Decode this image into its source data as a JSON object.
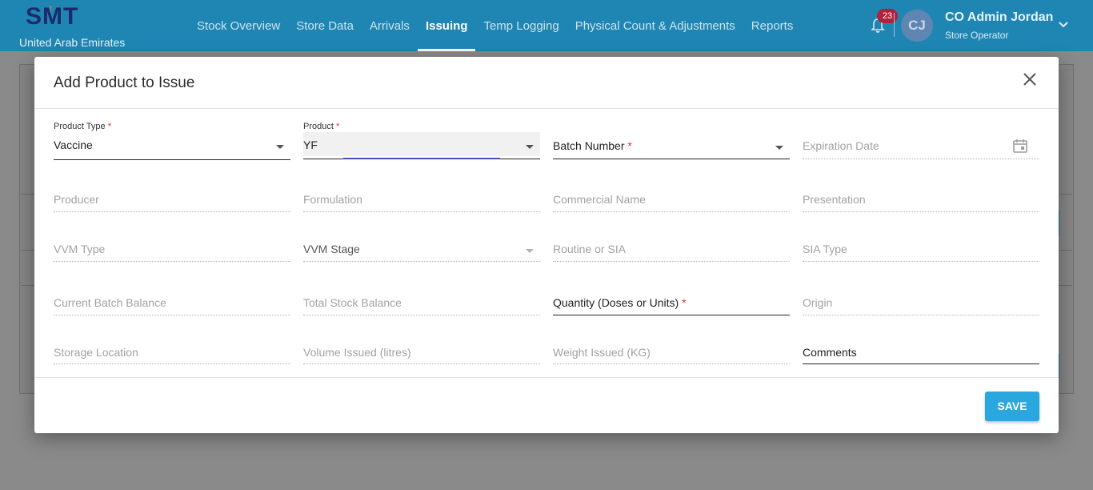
{
  "app": {
    "logo_text": "SMT",
    "country": "United Arab Emirates",
    "nav": [
      "Stock Overview",
      "Store Data",
      "Arrivals",
      "Issuing",
      "Temp Logging",
      "Physical Count & Adjustments",
      "Reports"
    ],
    "active_nav": "Issuing",
    "notifications_count": "23",
    "user": {
      "initials": "CJ",
      "name": "CO Admin Jordan",
      "role": "Store Operator"
    }
  },
  "modal": {
    "title": "Add Product to Issue",
    "save_label": "SAVE",
    "required_mark": "*",
    "fields": {
      "product_type": {
        "label": "Product Type",
        "value": "Vaccine"
      },
      "product": {
        "label": "Product",
        "value": "YF"
      },
      "batch_number": {
        "label": "Batch Number"
      },
      "expiration_date": {
        "label": "Expiration Date"
      },
      "producer": {
        "label": "Producer"
      },
      "formulation": {
        "label": "Formulation"
      },
      "commercial_name": {
        "label": "Commercial Name"
      },
      "presentation": {
        "label": "Presentation"
      },
      "vvm_type": {
        "label": "VVM Type"
      },
      "vvm_stage": {
        "label": "VVM Stage"
      },
      "routine_or_sia": {
        "label": "Routine or SIA"
      },
      "sia_type": {
        "label": "SIA Type"
      },
      "current_batch_balance": {
        "label": "Current Batch Balance"
      },
      "total_stock_balance": {
        "label": "Total Stock Balance"
      },
      "quantity": {
        "label": "Quantity (Doses or Units)"
      },
      "origin": {
        "label": "Origin"
      },
      "storage_location": {
        "label": "Storage Location"
      },
      "volume_issued": {
        "label": "Volume Issued (litres)"
      },
      "weight_issued": {
        "label": "Weight Issued (KG)"
      },
      "comments": {
        "label": "Comments"
      }
    }
  },
  "colors": {
    "brand": "#1f86b4",
    "accent": "#2aa7de",
    "required": "#e0312b",
    "focus": "#3f51b5"
  }
}
